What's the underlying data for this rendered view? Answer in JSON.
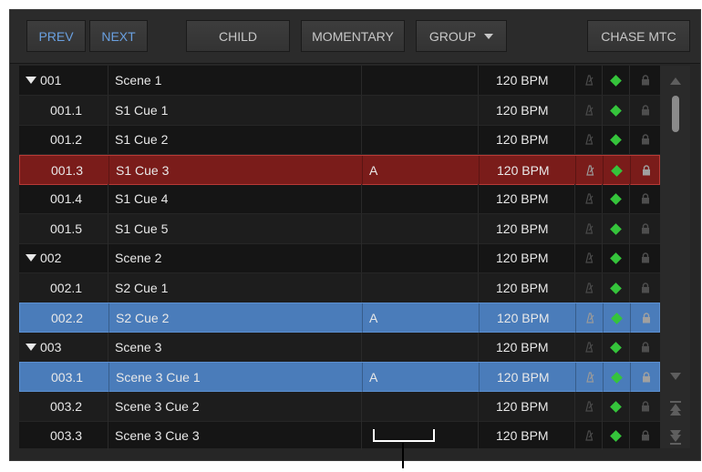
{
  "toolbar": {
    "prev": "PREV",
    "next": "NEXT",
    "child": "CHILD",
    "momentary": "MOMENTARY",
    "group": "GROUP",
    "chase": "CHASE MTC"
  },
  "rows": [
    {
      "num": "001",
      "name": "Scene 1",
      "a": "",
      "bpm": "120 BPM"
    },
    {
      "num": "001.1",
      "name": "S1 Cue 1",
      "a": "",
      "bpm": "120 BPM"
    },
    {
      "num": "001.2",
      "name": "S1 Cue 2",
      "a": "",
      "bpm": "120 BPM"
    },
    {
      "num": "001.3",
      "name": "S1 Cue 3",
      "a": "A",
      "bpm": "120 BPM"
    },
    {
      "num": "001.4",
      "name": "S1 Cue 4",
      "a": "",
      "bpm": "120 BPM"
    },
    {
      "num": "001.5",
      "name": "S1 Cue 5",
      "a": "",
      "bpm": "120 BPM"
    },
    {
      "num": "002",
      "name": "Scene 2",
      "a": "",
      "bpm": "120 BPM"
    },
    {
      "num": "002.1",
      "name": "S2 Cue 1",
      "a": "",
      "bpm": "120 BPM"
    },
    {
      "num": "002.2",
      "name": "S2 Cue 2",
      "a": "A",
      "bpm": "120 BPM"
    },
    {
      "num": "003",
      "name": "Scene 3",
      "a": "",
      "bpm": "120 BPM"
    },
    {
      "num": "003.1",
      "name": "Scene 3 Cue 1",
      "a": "A",
      "bpm": "120 BPM"
    },
    {
      "num": "003.2",
      "name": "Scene 3 Cue 2",
      "a": "",
      "bpm": "120 BPM"
    },
    {
      "num": "003.3",
      "name": "Scene 3 Cue 3",
      "a": "",
      "bpm": "120 BPM"
    }
  ],
  "colors": {
    "selected_red": "#7a1c1a",
    "selected_blue": "#4a7cba",
    "active_diamond": "#35c43b",
    "nav_text": "#6aa0e0"
  }
}
